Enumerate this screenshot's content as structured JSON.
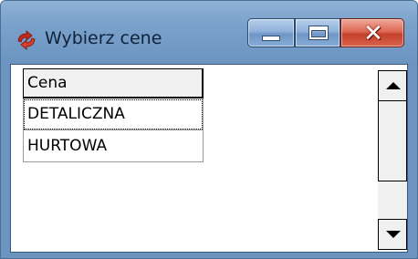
{
  "window": {
    "title": "Wybierz cene",
    "icon": "recycle-arrows-icon",
    "accent_color": "#6b94c0",
    "close_color": "#c5402b",
    "buttons": {
      "minimize": "minimize-icon",
      "maximize": "maximize-icon",
      "close_glyph": "✕"
    }
  },
  "grid": {
    "header": "Cena",
    "rows": [
      "DETALICZNA",
      "HURTOWA"
    ],
    "focused_row": 0
  },
  "scrollbar": {
    "up_icon": "arrow-up-icon",
    "down_icon": "arrow-down-icon"
  }
}
